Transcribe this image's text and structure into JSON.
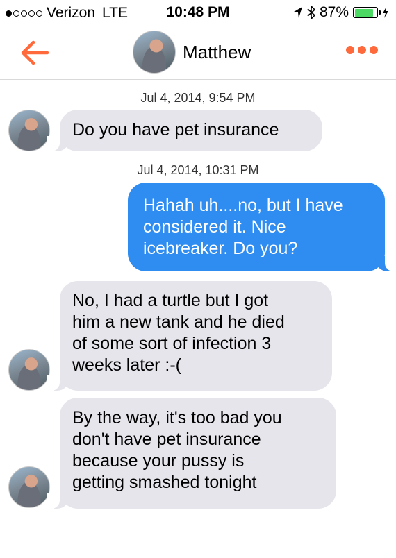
{
  "status_bar": {
    "signal_bars_filled": 1,
    "signal_bars_total": 5,
    "carrier": "Verizon",
    "network": "LTE",
    "time": "10:48 PM",
    "battery": "87%",
    "battery_level": 0.87
  },
  "header": {
    "back_icon": "arrow-left",
    "contact_name": "Matthew",
    "more_icon": "ellipsis",
    "accent_color": "#ff6a3c"
  },
  "messages": [
    {
      "type": "timestamp",
      "text": "Jul 4, 2014, 9:54 PM"
    },
    {
      "type": "incoming",
      "lines": [
        "Do you have pet insurance"
      ]
    },
    {
      "type": "timestamp",
      "text": "Jul 4, 2014, 10:31 PM"
    },
    {
      "type": "outgoing",
      "lines": [
        "Hahah uh....no, but I have",
        "considered it. Nice",
        "icebreaker. Do you?"
      ]
    },
    {
      "type": "incoming",
      "lines": [
        "No, I had a turtle but I got",
        "him a new tank and he died",
        "of some sort of infection 3",
        "weeks later :-("
      ]
    },
    {
      "type": "incoming",
      "lines": [
        "By the way, it's too bad you",
        "don't have pet insurance",
        "because your pussy is",
        "getting smashed tonight"
      ]
    }
  ],
  "colors": {
    "incoming_bubble": "#e6e5eb",
    "outgoing_bubble": "#2f8cf0"
  }
}
